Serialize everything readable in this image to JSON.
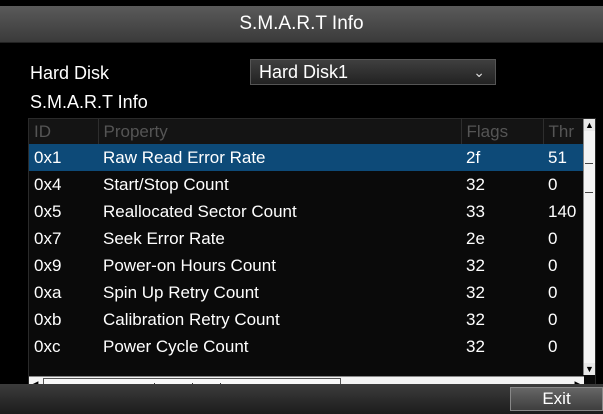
{
  "window": {
    "title": "S.M.A.R.T Info"
  },
  "hard_disk": {
    "label": "Hard Disk",
    "selected": "Hard Disk1"
  },
  "section_label": "S.M.A.R.T Info",
  "table": {
    "headers": [
      "ID",
      "Property",
      "Flags",
      "Thr"
    ],
    "selected_row": 0,
    "rows": [
      [
        "0x1",
        "Raw Read Error Rate",
        "2f",
        "51"
      ],
      [
        "0x4",
        "Start/Stop Count",
        "32",
        "0"
      ],
      [
        "0x5",
        "Reallocated Sector Count",
        "33",
        "140"
      ],
      [
        "0x7",
        "Seek Error Rate",
        "2e",
        "0"
      ],
      [
        "0x9",
        "Power-on Hours Count",
        "32",
        "0"
      ],
      [
        "0xa",
        "Spin Up Retry Count",
        "32",
        "0"
      ],
      [
        "0xb",
        "Calibration Retry Count",
        "32",
        "0"
      ],
      [
        "0xc",
        "Power Cycle Count",
        "32",
        "0"
      ]
    ]
  },
  "scroll": {
    "vertical_up_icon": "arrow-up-icon",
    "vertical_down_icon": "arrow-down-icon",
    "left_icon": "arrow-left-icon",
    "right_icon": "arrow-right-icon"
  },
  "buttons": {
    "exit": "Exit"
  },
  "colors": {
    "selection": "#0d4a78",
    "titlebar": "#4a4a4a",
    "background": "#000000"
  }
}
